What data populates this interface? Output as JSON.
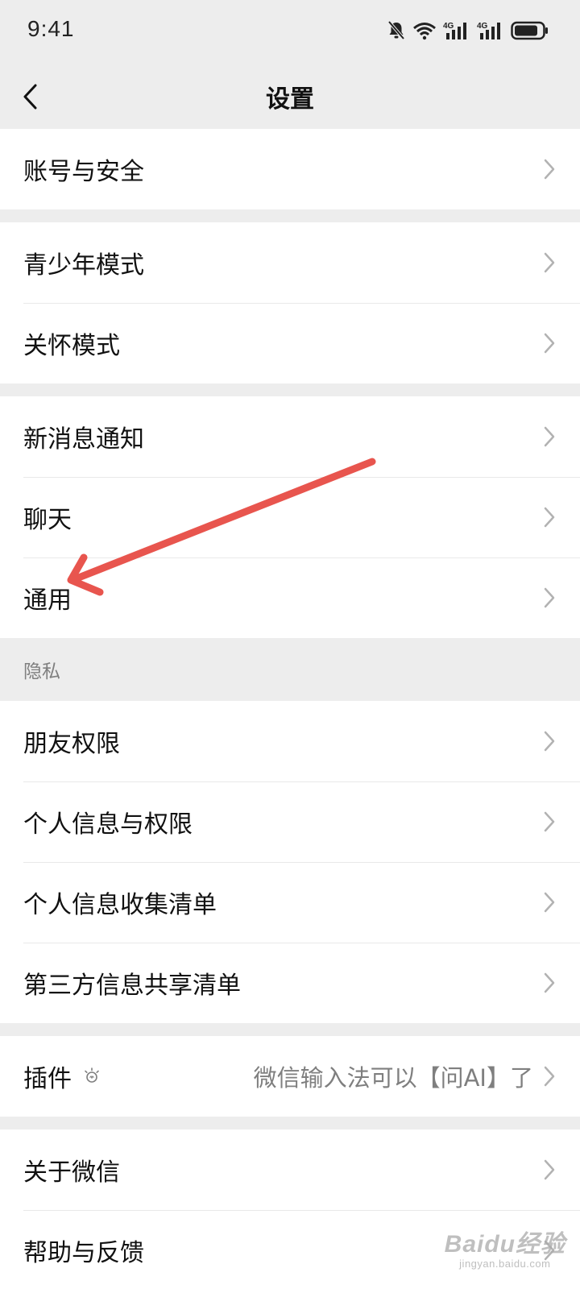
{
  "status_bar": {
    "time": "9:41",
    "network_label_1": "4G",
    "network_label_2": "4G",
    "icons": [
      "bell-muted-icon",
      "wifi-icon",
      "signal-4g-icon",
      "signal-4g-icon",
      "battery-icon"
    ]
  },
  "nav": {
    "title": "设置",
    "back_icon": "chevron-left-icon"
  },
  "groups": [
    {
      "items": [
        {
          "label": "账号与安全"
        }
      ]
    },
    {
      "items": [
        {
          "label": "青少年模式"
        },
        {
          "label": "关怀模式"
        }
      ]
    },
    {
      "items": [
        {
          "label": "新消息通知"
        },
        {
          "label": "聊天"
        },
        {
          "label": "通用"
        }
      ]
    }
  ],
  "privacy": {
    "header": "隐私",
    "items": [
      {
        "label": "朋友权限"
      },
      {
        "label": "个人信息与权限"
      },
      {
        "label": "个人信息收集清单"
      },
      {
        "label": "第三方信息共享清单"
      }
    ]
  },
  "plugins": {
    "label": "插件",
    "icon": "bulb-icon",
    "hint": "微信输入法可以【问AI】了"
  },
  "about": {
    "items": [
      {
        "label": "关于微信"
      },
      {
        "label": "帮助与反馈"
      }
    ]
  },
  "annotation": {
    "type": "arrow",
    "color": "#e8554e",
    "points_to": "通用"
  },
  "watermark": {
    "main": "Baidu经验",
    "sub": "jingyan.baidu.com"
  },
  "colors": {
    "background": "#ededed",
    "cell": "#ffffff",
    "text": "#111111",
    "secondary_text": "#7f7f7f",
    "chevron": "#b2b2b2",
    "annotation_arrow": "#e8554e"
  }
}
